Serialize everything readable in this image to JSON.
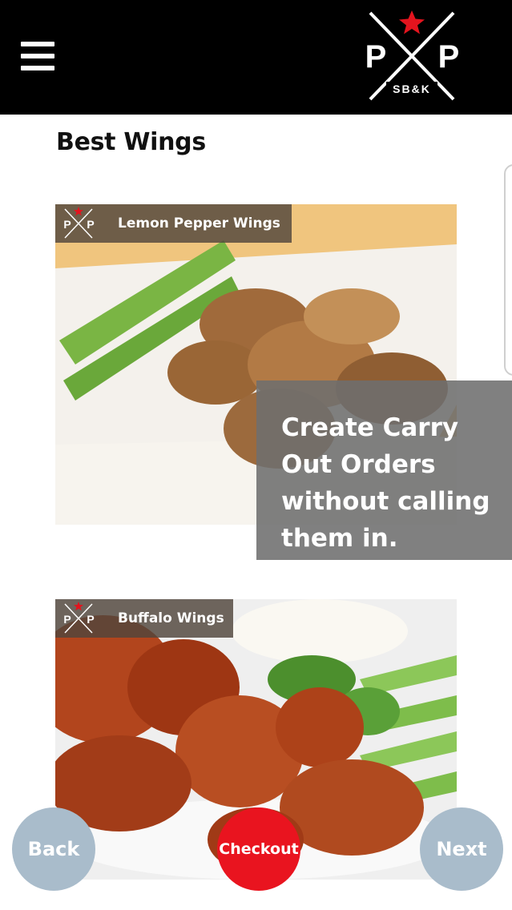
{
  "header": {
    "logo": {
      "letter_left": "P",
      "letter_right": "P",
      "sub": "SB&K"
    }
  },
  "title": "Best Wings",
  "cards": [
    {
      "label": "Lemon Pepper Wings"
    },
    {
      "label": "Buffalo Wings"
    }
  ],
  "promo": {
    "text": "Create Carry Out Orders without calling them in."
  },
  "buttons": {
    "back": "Back",
    "checkout": "Checkout",
    "next": "Next"
  },
  "colors": {
    "header_bg": "#000000",
    "nav_button": "#a9bccb",
    "checkout_button": "#e9141f",
    "logo_star": "#e3141e"
  }
}
